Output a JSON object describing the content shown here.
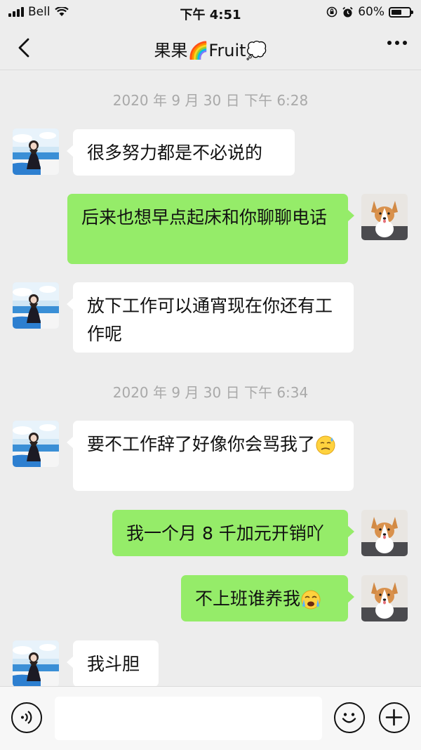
{
  "status_bar": {
    "carrier": "Bell",
    "time": "下午 4:51",
    "battery_percent": "60%",
    "battery_level": 0.6,
    "icons": [
      "signal-icon",
      "wifi-icon",
      "orientation-lock-icon",
      "alarm-icon",
      "battery-icon"
    ]
  },
  "nav": {
    "title": "果果🌈Fruit💭",
    "icons": [
      "back-chevron-icon",
      "more-dots-icon"
    ]
  },
  "chat": {
    "timestamps": [
      "2020 年 9 月 30 日  下午 6:28",
      "2020 年 9 月 30 日  下午 6:34"
    ],
    "messages": [
      {
        "side": "left",
        "text": "很多努力都是不必说的"
      },
      {
        "side": "right",
        "text": "后来也想早点起床和你聊聊电话"
      },
      {
        "side": "left",
        "text": "放下工作可以通宵现在你还有工作呢"
      },
      {
        "side": "left",
        "text": "要不工作辞了好像你会骂我了",
        "emoji": "😓"
      },
      {
        "side": "right",
        "text": "我一个月 8 千加元开销吖"
      },
      {
        "side": "right",
        "text": "不上班谁养我",
        "emoji": "😭"
      },
      {
        "side": "left",
        "text": "我斗胆"
      }
    ]
  },
  "input_bar": {
    "placeholder": "",
    "icons": [
      "voice-icon",
      "emoji-icon",
      "add-icon"
    ]
  },
  "colors": {
    "background": "#ededed",
    "bubble_self": "#95ec69",
    "bubble_other": "#ffffff",
    "timestamp_text": "#a9a9a9"
  }
}
